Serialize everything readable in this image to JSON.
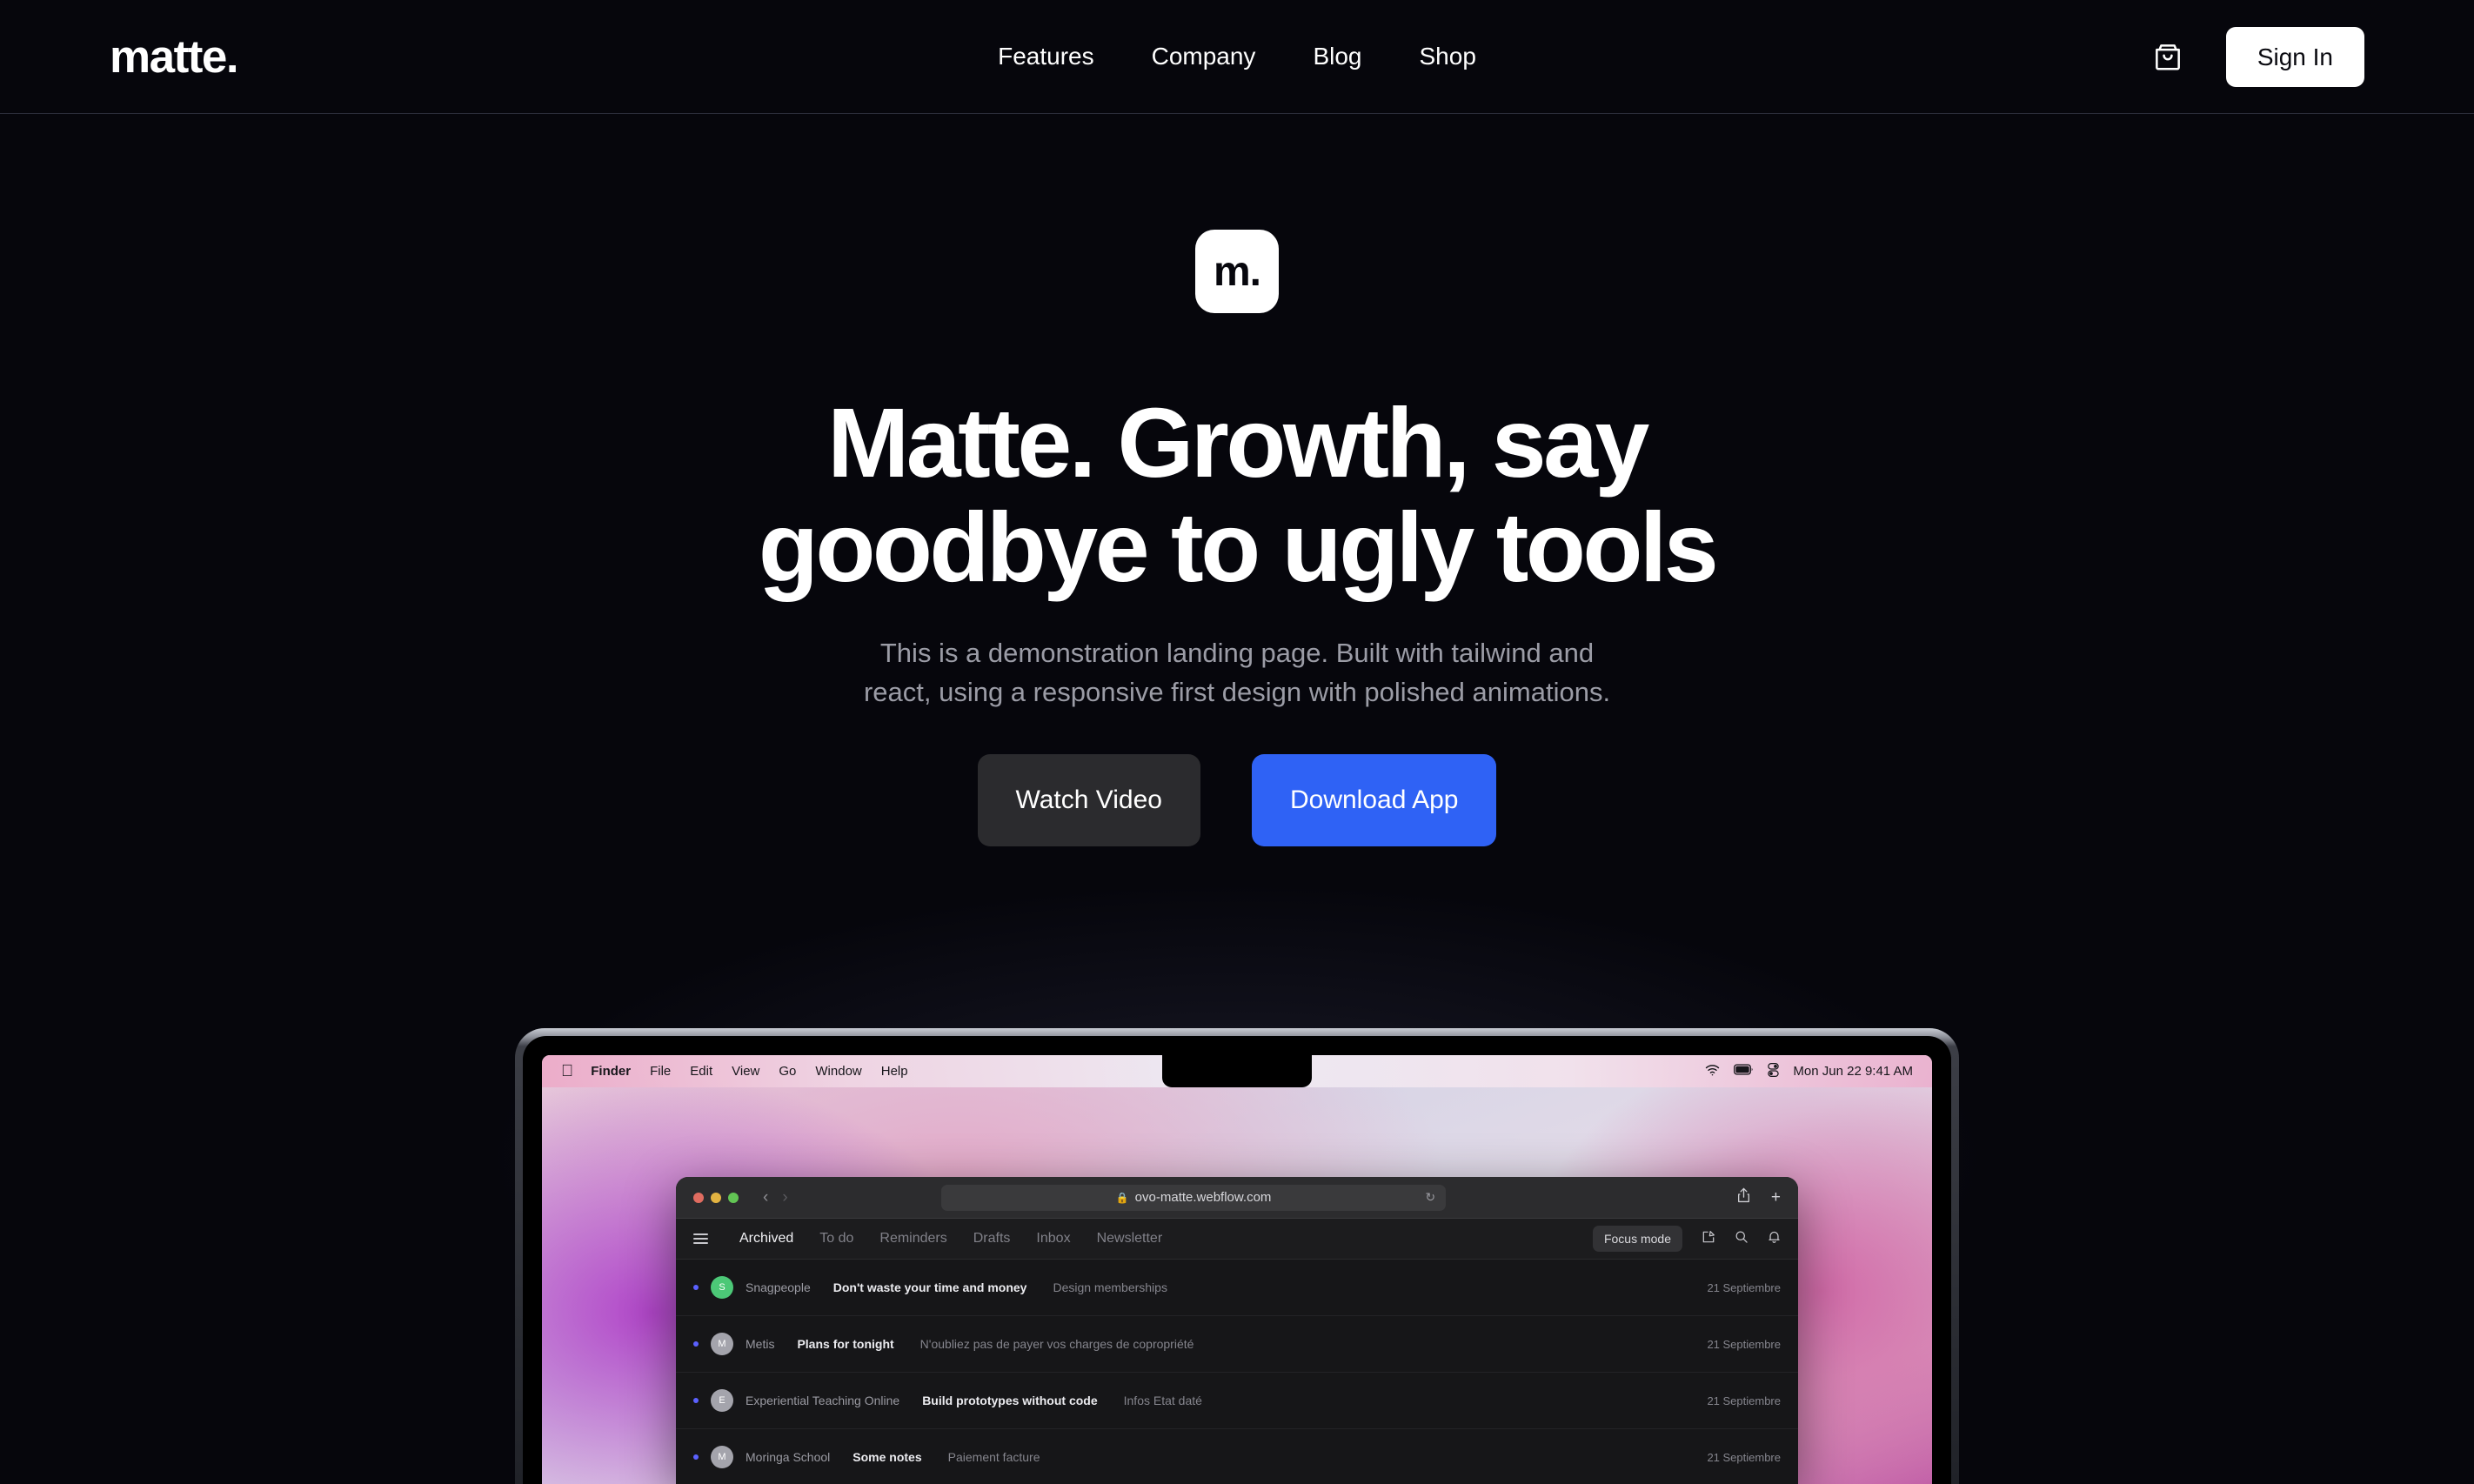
{
  "theme": {
    "background": "#06060c",
    "accent_blue": "#2f62f5",
    "text_primary": "#ffffff",
    "text_muted": "#9b9ca6",
    "header_border": "#2b2d3a"
  },
  "header": {
    "logo": "matte.",
    "nav": [
      {
        "label": "Features"
      },
      {
        "label": "Company"
      },
      {
        "label": "Blog"
      },
      {
        "label": "Shop"
      }
    ],
    "cart_icon": "shopping-bag-icon",
    "signin_label": "Sign In"
  },
  "hero": {
    "badge": "m.",
    "title_line1": "Matte. Growth, say",
    "title_line2": "goodbye to ugly tools",
    "subtitle_line1": "This is a demonstration landing page. Built with tailwind and",
    "subtitle_line2": "react, using a responsive first design with polished animations.",
    "cta_secondary": "Watch Video",
    "cta_primary": "Download App"
  },
  "mockup": {
    "macos_menubar": {
      "apple": "",
      "items": [
        "Finder",
        "File",
        "Edit",
        "View",
        "Go",
        "Window",
        "Help"
      ],
      "status_icons": [
        "wifi-icon",
        "battery-icon",
        "control-center-icon"
      ],
      "clock": "Mon Jun 22  9:41 AM"
    },
    "browser": {
      "traffic_lights": [
        "close",
        "minimize",
        "zoom"
      ],
      "back_icon": "chevron-left-icon",
      "forward_icon": "chevron-right-icon",
      "lock_icon": "lock-icon",
      "url": "ovo-matte.webflow.com",
      "reload_icon": "reload-icon",
      "share_icon": "share-icon",
      "newtab_icon": "plus-icon"
    },
    "app": {
      "menu_icon": "hamburger-icon",
      "tabs": [
        {
          "label": "Archived",
          "active": true
        },
        {
          "label": "To do",
          "active": false
        },
        {
          "label": "Reminders",
          "active": false
        },
        {
          "label": "Drafts",
          "active": false
        },
        {
          "label": "Inbox",
          "active": false
        },
        {
          "label": "Newsletter",
          "active": false
        }
      ],
      "focus_mode": "Focus mode",
      "actions": [
        "compose-icon",
        "search-icon",
        "bell-icon"
      ],
      "rows": [
        {
          "initial": "S",
          "avatar_color": "#4cc877",
          "sender": "Snagpeople",
          "subject": "Don't waste your time and money",
          "snippet": "Design memberships",
          "date": "21 Septiembre"
        },
        {
          "initial": "M",
          "avatar_color": "#a4a4ac",
          "sender": "Metis",
          "subject": "Plans for tonight",
          "snippet": "N'oubliez pas de payer vos charges de copropriété",
          "date": "21 Septiembre"
        },
        {
          "initial": "E",
          "avatar_color": "#a4a4ac",
          "sender": "Experiential Teaching Online",
          "subject": "Build prototypes without code",
          "snippet": "Infos Etat daté",
          "date": "21 Septiembre"
        },
        {
          "initial": "M",
          "avatar_color": "#a4a4ac",
          "sender": "Moringa School",
          "subject": "Some notes",
          "snippet": "Paiement facture",
          "date": "21 Septiembre"
        }
      ]
    }
  }
}
